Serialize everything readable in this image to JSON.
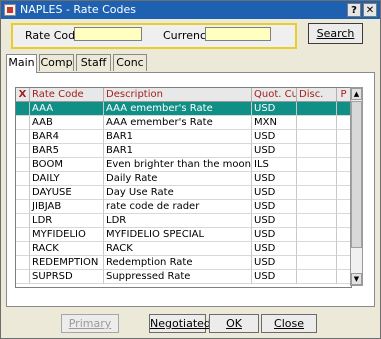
{
  "window": {
    "title": "NAPLES - Rate Codes",
    "help_label": "?",
    "close_label": "✕"
  },
  "search": {
    "rate_code_label": "Rate Code",
    "rate_code_value": "",
    "currency_label": "Currency",
    "currency_value": "",
    "search_button": "Search"
  },
  "tabs": [
    {
      "label": "Main",
      "active": true
    },
    {
      "label": "Comp",
      "active": false
    },
    {
      "label": "Staff",
      "active": false
    },
    {
      "label": "Conc",
      "active": false
    }
  ],
  "grid": {
    "headers": [
      "X",
      "Rate Code",
      "Description",
      "Quot. Curr",
      "Disc.",
      "P"
    ],
    "rows": [
      {
        "code": "AAA",
        "description": "AAA emember's Rate",
        "currency": "USD",
        "selected": true
      },
      {
        "code": "AAB",
        "description": "AAA emember's Rate",
        "currency": "MXN",
        "selected": false
      },
      {
        "code": "BAR4",
        "description": "BAR1",
        "currency": "USD",
        "selected": false
      },
      {
        "code": "BAR5",
        "description": "BAR1",
        "currency": "USD",
        "selected": false
      },
      {
        "code": "BOOM",
        "description": "Even brighter than the moon",
        "currency": "ILS",
        "selected": false
      },
      {
        "code": "DAILY",
        "description": "Daily Rate",
        "currency": "USD",
        "selected": false
      },
      {
        "code": "DAYUSE",
        "description": "Day Use Rate",
        "currency": "USD",
        "selected": false
      },
      {
        "code": "JIBJAB",
        "description": "rate code de rader",
        "currency": "USD",
        "selected": false
      },
      {
        "code": "LDR",
        "description": "LDR",
        "currency": "USD",
        "selected": false
      },
      {
        "code": "MYFIDELIO",
        "description": "MYFIDELIO SPECIAL",
        "currency": "USD",
        "selected": false
      },
      {
        "code": "RACK",
        "description": "RACK",
        "currency": "USD",
        "selected": false
      },
      {
        "code": "REDEMPTION",
        "description": "Redemption Rate",
        "currency": "USD",
        "selected": false
      },
      {
        "code": "SUPRSD",
        "description": "Suppressed Rate",
        "currency": "USD",
        "selected": false
      }
    ]
  },
  "buttons": {
    "primary": "Primary",
    "negotiated": "Negotiated",
    "ok": "OK",
    "close": "Close"
  },
  "colors": {
    "title_bar": "#1f61b1",
    "selected_row": "#0f8f86",
    "search_border": "#e6cf2a",
    "field_bg": "#ffffc0",
    "header_text": "#a32020"
  }
}
